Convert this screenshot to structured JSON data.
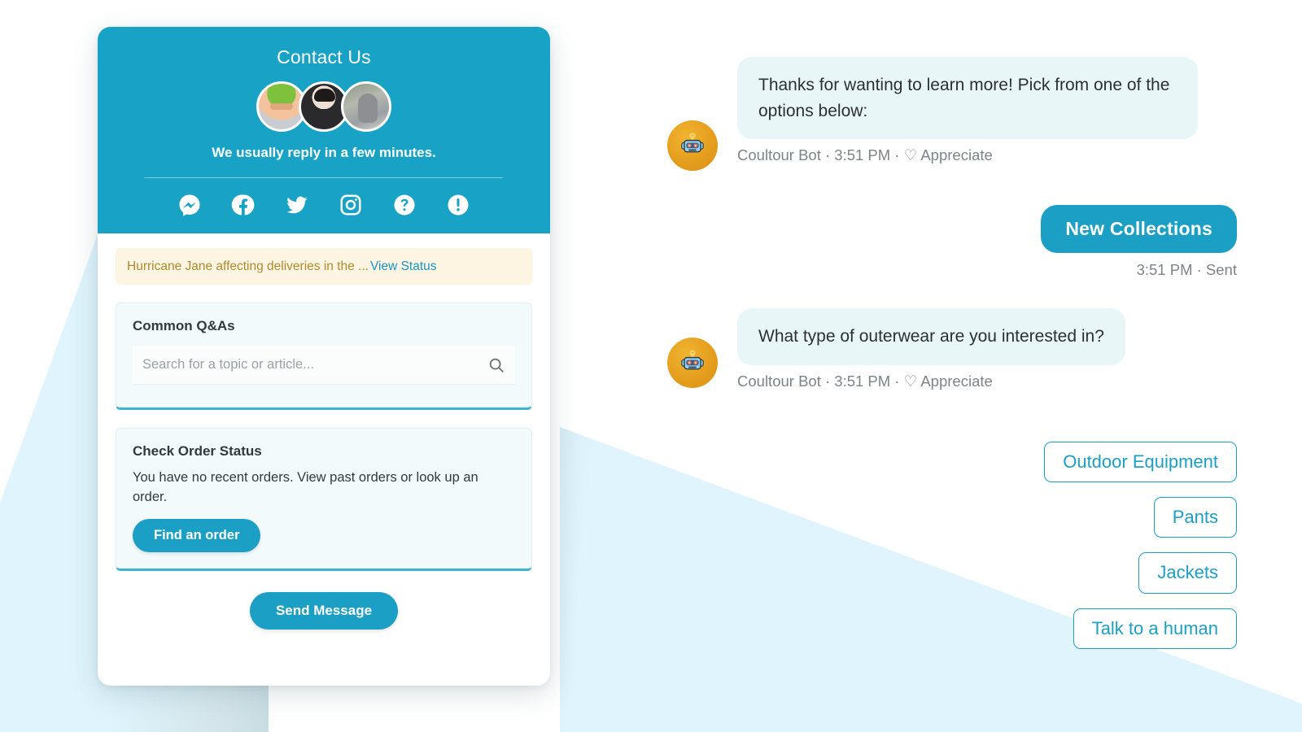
{
  "theme": {
    "accent": "#17a2c6",
    "accent_button": "#1b9fc4",
    "bubble_in_bg": "#e8f6f8",
    "wedge_bg": "#dff4fc",
    "alert_bg": "#fdf5e2",
    "alert_text": "#b08a2e",
    "card_bg": "#f2fafb",
    "bot_avatar_bg": "#e49c1b"
  },
  "widget": {
    "header": {
      "title": "Contact Us",
      "reply_time": "We usually reply in a few minutes.",
      "avatars": [
        {
          "name": "agent-avatar-1"
        },
        {
          "name": "agent-avatar-2"
        },
        {
          "name": "agent-avatar-3"
        }
      ],
      "social": [
        {
          "icon": "messenger-icon",
          "label": "Messenger"
        },
        {
          "icon": "facebook-icon",
          "label": "Facebook"
        },
        {
          "icon": "twitter-icon",
          "label": "Twitter"
        },
        {
          "icon": "instagram-icon",
          "label": "Instagram"
        },
        {
          "icon": "question-circle-icon",
          "label": "Help"
        },
        {
          "icon": "exclamation-circle-icon",
          "label": "Alerts"
        }
      ]
    },
    "alert": {
      "text": "Hurricane Jane affecting deliveries in the ...",
      "link_label": "View Status"
    },
    "qa_card": {
      "title": "Common Q&As",
      "search_placeholder": "Search for a topic or article...",
      "search_value": "",
      "search_icon": "search-icon"
    },
    "order_card": {
      "title": "Check Order Status",
      "description": "You have no recent orders. View past orders or look up an order.",
      "button_label": "Find an order"
    },
    "footer": {
      "send_message_label": "Send Message"
    }
  },
  "chat": {
    "messages": [
      {
        "direction": "in",
        "avatar_icon": "robot-icon",
        "text": "Thanks for wanting to learn more! Pick from one of the options below:",
        "sender": "Coultour Bot",
        "time": "3:51 PM",
        "reaction_icon": "heart-icon",
        "reaction_label": "Appreciate",
        "meta": "Coultour Bot · 3:51 PM · "
      },
      {
        "direction": "out",
        "text": "New Collections",
        "time": "3:51 PM",
        "status": "Sent",
        "meta": "3:51 PM · Sent"
      },
      {
        "direction": "in",
        "avatar_icon": "robot-icon",
        "text": "What type of outerwear are you interested in?",
        "sender": "Coultour Bot",
        "time": "3:51 PM",
        "reaction_icon": "heart-icon",
        "reaction_label": "Appreciate",
        "meta": "Coultour Bot · 3:51 PM · "
      }
    ],
    "quick_replies": [
      {
        "label": "Outdoor Equipment"
      },
      {
        "label": "Pants"
      },
      {
        "label": "Jackets"
      },
      {
        "label": "Talk to a human"
      }
    ]
  }
}
